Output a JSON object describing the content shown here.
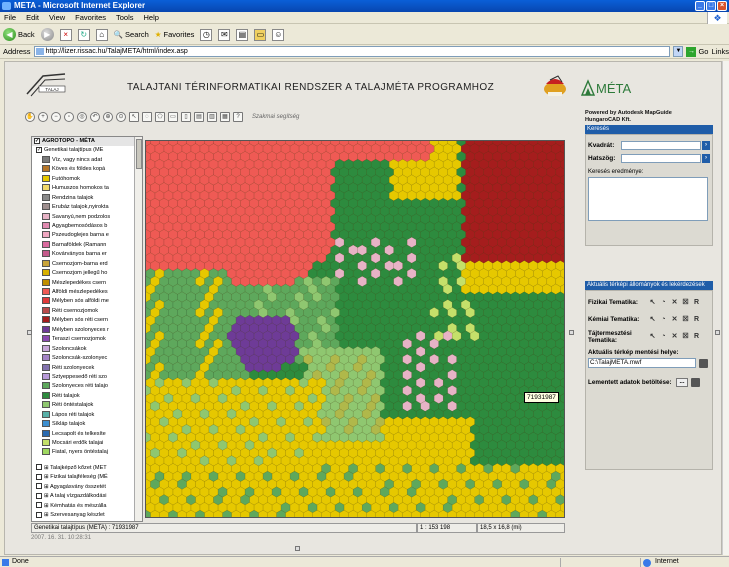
{
  "window": {
    "title": "META - Microsoft Internet Explorer"
  },
  "menu": [
    "File",
    "Edit",
    "View",
    "Favorites",
    "Tools",
    "Help"
  ],
  "toolbar": {
    "back": "Back",
    "search": "Search",
    "favorites": "Favorites"
  },
  "address": {
    "label": "Address",
    "url": "http://lizer.rissac.hu/TalajMETA/html/index.asp",
    "go": "Go",
    "links": "Links"
  },
  "header": {
    "title": "TALAJTANI TÉRINFORMATIKAI RENDSZER A TALAJMÉTA PROGRAMHOZ",
    "logo_text": "MÉTA",
    "left_logo_text": "TALAJ"
  },
  "maptools": {
    "help_label": "Szakmai segítség"
  },
  "legend": {
    "root": "AGROTOPO - MÉTA",
    "group": "Genetikai talajtípus (ME",
    "items": [
      {
        "label": "Víz, vagy nincs adat",
        "color": "#7a7a7a"
      },
      {
        "label": "Köves és földes kopá",
        "color": "#b5762a"
      },
      {
        "label": "Futóhomok",
        "color": "#e6c800"
      },
      {
        "label": "Humuszos homokos ta",
        "color": "#f1d86a"
      },
      {
        "label": "Rendzina talajok",
        "color": "#8a8a8a"
      },
      {
        "label": "Erubáz talajok,nyirokta",
        "color": "#9f8f8f"
      },
      {
        "label": "Savanyú,nem podzolos",
        "color": "#e7b3c6"
      },
      {
        "label": "Agyagbemosódásos b",
        "color": "#e08ab0"
      },
      {
        "label": "Pszeudoglejes barna e",
        "color": "#f0a8c2"
      },
      {
        "label": "Barnaföldek (Ramann",
        "color": "#d96a9e"
      },
      {
        "label": "Kovárványos barna er",
        "color": "#c55b8c"
      },
      {
        "label": "Csernozjom-barna erd",
        "color": "#c9a43a"
      },
      {
        "label": "Csernozjom jellegű ho",
        "color": "#d8b000"
      },
      {
        "label": "Mészlepedékes csern",
        "color": "#c08f00"
      },
      {
        "label": "Alföldi mészlepedékes",
        "color": "#ef5a54"
      },
      {
        "label": "Mélyben sós alföldi me",
        "color": "#e03a3a"
      },
      {
        "label": "Réti csernozjomok",
        "color": "#b84a4a"
      },
      {
        "label": "Mélyben sós réti csern",
        "color": "#a51d1d"
      },
      {
        "label": "Mélyben szolonyeces r",
        "color": "#6e3b97"
      },
      {
        "label": "Teraszi csernozjomok",
        "color": "#8b4ab0"
      },
      {
        "label": "Szoloncsákok",
        "color": "#c7a6d8"
      },
      {
        "label": "Szoloncsák-szolonyec",
        "color": "#a484c7"
      },
      {
        "label": "Réti szolonyecek",
        "color": "#8272ae"
      },
      {
        "label": "Sztyeppesedő réti szo",
        "color": "#b89ad8"
      },
      {
        "label": "Szolonyeces réti talajo",
        "color": "#5ea85c"
      },
      {
        "label": "Réti talajok",
        "color": "#2d8b3e"
      },
      {
        "label": "Réti öntéstalajok",
        "color": "#8fc770"
      },
      {
        "label": "Lápos réti talajok",
        "color": "#58b0a8"
      },
      {
        "label": "Síkláp talajok",
        "color": "#3d8fd0"
      },
      {
        "label": "Lecsapolt és telkesíte",
        "color": "#2a6ab0"
      },
      {
        "label": "Mocsári erdők talajai",
        "color": "#c4e06a"
      },
      {
        "label": "Fiatal, nyers öntéstalaj",
        "color": "#9fd860"
      }
    ],
    "other_groups": [
      "Talajképző kőzet (MET",
      "Fizikai talajféleség (MÉ",
      "Agyagásvány összetét",
      "A talaj vízgazdálkodási",
      "Kémhatás és mészálla",
      "Szervesanyag készlet"
    ]
  },
  "map": {
    "tooltip": "71931987"
  },
  "map_status": {
    "layer": "Genetikai talajtípus (META) : 71931987",
    "scale": "1 : 153 198",
    "extent": "18,5 x 16,8 (mi)"
  },
  "datestamp": "2007. 16. 31. 10:28:31",
  "right_panel": {
    "powered1": "Powered by Autodesk MapGuide",
    "powered2": "HungaroCAD Kft.",
    "search_head": "Keresés",
    "kvadrat": "Kvadrát:",
    "hatszog": "Hatszög:",
    "results": "Keresés eredménye:",
    "actual_head": "Aktuális térképi állományok és lekérdezések",
    "thematics": [
      {
        "label": "Fizikai Tematika:"
      },
      {
        "label": "Kémiai Tematika:"
      },
      {
        "label": "Tájtermesztési Tematika:"
      }
    ],
    "save_label": "Aktuális térkép mentési helye:",
    "save_path": "C:\\TalajMETA.mwf",
    "load_label": "Lementett adatok betöltése:",
    "dots": "..."
  },
  "status": {
    "text": "Done",
    "zone": "Internet"
  },
  "colors": {
    "accent": "#1f5da8"
  }
}
